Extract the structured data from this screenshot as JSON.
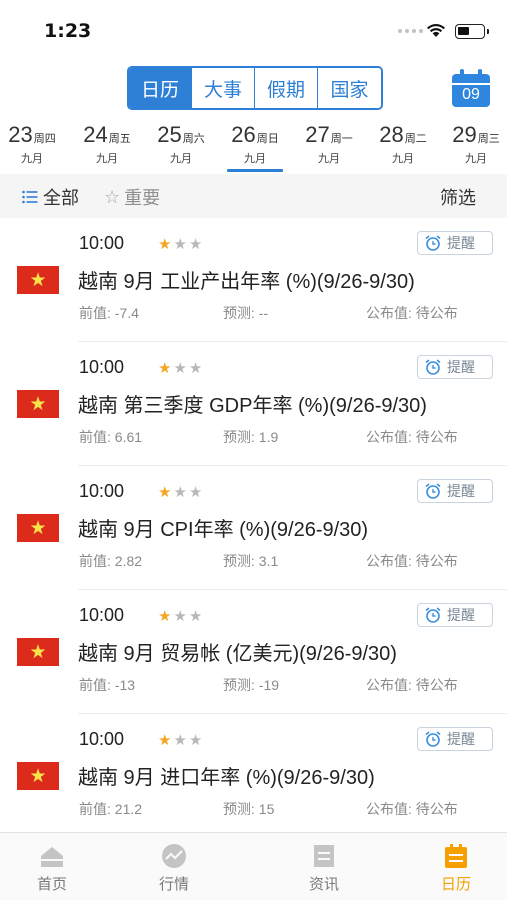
{
  "status": {
    "time": "1:23"
  },
  "segments": [
    {
      "label": "日历",
      "active": true
    },
    {
      "label": "大事",
      "active": false
    },
    {
      "label": "假期",
      "active": false
    },
    {
      "label": "国家",
      "active": false
    }
  ],
  "calendar_button": {
    "day": "09"
  },
  "days": [
    {
      "num": "23",
      "weekday": "周四",
      "month": "九月",
      "selected": false
    },
    {
      "num": "24",
      "weekday": "周五",
      "month": "九月",
      "selected": false
    },
    {
      "num": "25",
      "weekday": "周六",
      "month": "九月",
      "selected": false
    },
    {
      "num": "26",
      "weekday": "周日",
      "month": "九月",
      "selected": true
    },
    {
      "num": "27",
      "weekday": "周一",
      "month": "九月",
      "selected": false
    },
    {
      "num": "28",
      "weekday": "周二",
      "month": "九月",
      "selected": false
    },
    {
      "num": "29",
      "weekday": "周三",
      "month": "九月",
      "selected": false
    }
  ],
  "filter": {
    "all": "全部",
    "important": "重要",
    "filter": "筛选"
  },
  "items": [
    {
      "time": "10:00",
      "stars": 1,
      "remind": "提醒",
      "title": "越南 9月 工业产出年率 (%)(9/26-9/30)",
      "prev": "前值: -7.4",
      "forecast": "预测: --",
      "actual": "公布值: 待公布"
    },
    {
      "time": "10:00",
      "stars": 1,
      "remind": "提醒",
      "title": "越南 第三季度 GDP年率 (%)(9/26-9/30)",
      "prev": "前值: 6.61",
      "forecast": "预测: 1.9",
      "actual": "公布值: 待公布"
    },
    {
      "time": "10:00",
      "stars": 1,
      "remind": "提醒",
      "title": "越南 9月 CPI年率 (%)(9/26-9/30)",
      "prev": "前值: 2.82",
      "forecast": "预测: 3.1",
      "actual": "公布值: 待公布"
    },
    {
      "time": "10:00",
      "stars": 1,
      "remind": "提醒",
      "title": "越南 9月 贸易帐 (亿美元)(9/26-9/30)",
      "prev": "前值: -13",
      "forecast": "预测: -19",
      "actual": "公布值: 待公布"
    },
    {
      "time": "10:00",
      "stars": 1,
      "remind": "提醒",
      "title": "越南 9月 进口年率 (%)(9/26-9/30)",
      "prev": "前值: 21.2",
      "forecast": "预测: 15",
      "actual": "公布值: 待公布"
    }
  ],
  "tabs": [
    {
      "label": "首页",
      "icon": "home-icon",
      "active": false
    },
    {
      "label": "行情",
      "icon": "market-icon",
      "active": false
    },
    {
      "label": "资讯",
      "icon": "news-icon",
      "active": false
    },
    {
      "label": "日历",
      "icon": "calendar-icon",
      "active": true
    }
  ],
  "colors": {
    "accent": "#2e7fd6",
    "active_tab": "#f5a000",
    "flag_red": "#dd2b1b",
    "flag_star": "#f7e44a",
    "star_on": "#f5a623"
  }
}
